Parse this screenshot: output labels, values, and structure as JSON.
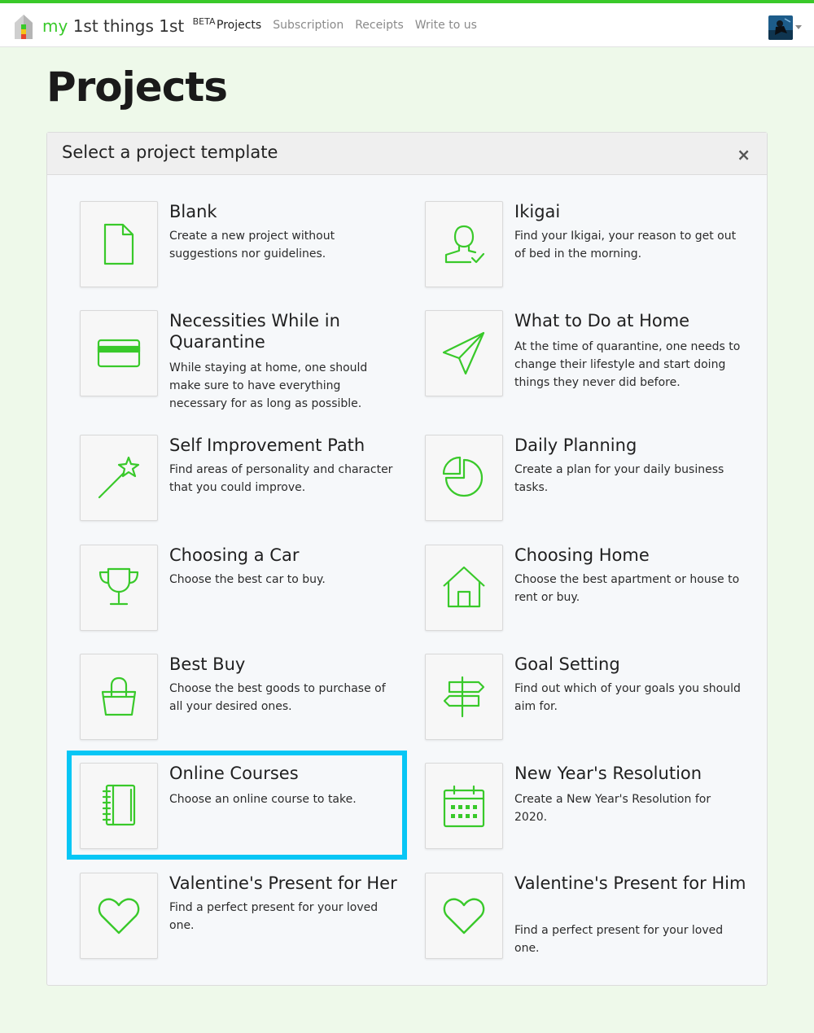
{
  "brand": {
    "my": "my",
    "name": "1st things 1st",
    "badge": "BETA"
  },
  "nav": [
    "Projects",
    "Subscription",
    "Receipts",
    "Write to us"
  ],
  "page_title": "Projects",
  "panel": {
    "title": "Select a project template",
    "close": "×"
  },
  "templates": [
    {
      "title": "Blank",
      "desc": "Create a new project without suggestions nor guidelines.",
      "icon": "document-icon"
    },
    {
      "title": "Ikigai",
      "desc": "Find your Ikigai, your reason to get out of bed in the morning.",
      "icon": "user-check-icon"
    },
    {
      "title": "Necessities While in Quarantine",
      "desc": "While staying at home, one should make sure to have everything necessary for as long as possible.",
      "icon": "credit-card-icon"
    },
    {
      "title": "What to Do at Home",
      "desc": "At the time of quarantine, one needs to change their lifestyle and start doing things they never did before.",
      "icon": "paper-plane-icon"
    },
    {
      "title": "Self Improvement Path",
      "desc": "Find areas of personality and character that you could improve.",
      "icon": "magic-wand-icon"
    },
    {
      "title": "Daily Planning",
      "desc": "Create a plan for your daily business tasks.",
      "icon": "pie-chart-icon"
    },
    {
      "title": "Choosing a Car",
      "desc": "Choose the best car to buy.",
      "icon": "trophy-icon"
    },
    {
      "title": "Choosing Home",
      "desc": "Choose the best apartment or house to rent or buy.",
      "icon": "house-icon"
    },
    {
      "title": "Best Buy",
      "desc": "Choose the best goods to purchase of all your desired ones.",
      "icon": "shopping-bag-icon"
    },
    {
      "title": "Goal Setting",
      "desc": "Find out which of your goals you should aim for.",
      "icon": "signpost-icon"
    },
    {
      "title": "Online Courses",
      "desc": "Choose an online course to take.",
      "icon": "notebook-icon"
    },
    {
      "title": "New Year's Resolution",
      "desc": "Create a New Year's Resolution for 2020.",
      "icon": "calendar-icon"
    },
    {
      "title": "Valentine's Present for Her",
      "desc": "Find a perfect present for your loved one.",
      "icon": "heart-icon"
    },
    {
      "title": "Valentine's Present for Him",
      "desc": "Find a perfect present for your loved one.",
      "icon": "heart-icon"
    }
  ],
  "colors": {
    "accent": "#39c92a",
    "highlight": "#07c6f5"
  }
}
